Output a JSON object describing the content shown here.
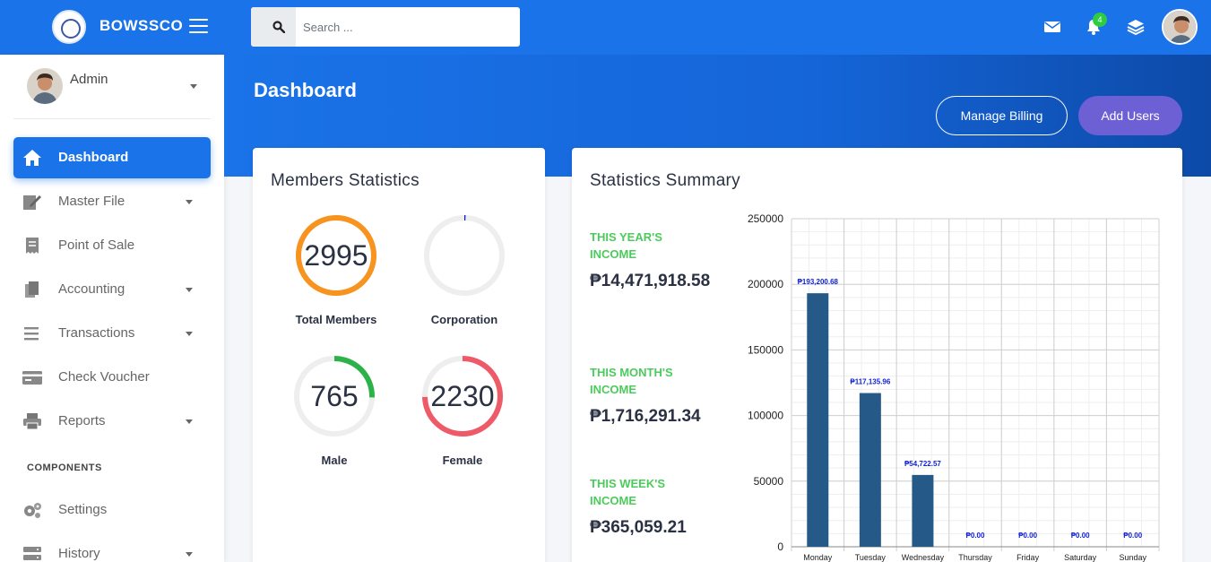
{
  "brand": {
    "name": "BOWSSCO"
  },
  "search": {
    "placeholder": "Search ..."
  },
  "notifications": {
    "count": "4"
  },
  "sidebar": {
    "user": {
      "name": "Admin"
    },
    "items": [
      {
        "label": "Dashboard",
        "icon": "home-icon"
      },
      {
        "label": "Master File",
        "icon": "edit-file-icon"
      },
      {
        "label": "Point of Sale",
        "icon": "receipt-icon"
      },
      {
        "label": "Accounting",
        "icon": "copy-icon"
      },
      {
        "label": "Transactions",
        "icon": "list-icon"
      },
      {
        "label": "Check Voucher",
        "icon": "credit-card-icon"
      },
      {
        "label": "Reports",
        "icon": "printer-icon"
      }
    ],
    "section": "COMPONENTS",
    "components": [
      {
        "label": "Settings",
        "icon": "gears-icon"
      },
      {
        "label": "History",
        "icon": "server-icon"
      }
    ]
  },
  "page": {
    "title": "Dashboard",
    "manage_billing": "Manage Billing",
    "add_users": "Add Users"
  },
  "members": {
    "title": "Members Statistics",
    "total": {
      "value": "2995",
      "label": "Total Members",
      "fraction": 1.0,
      "color": "#f7931e"
    },
    "corporation": {
      "value": "",
      "label": "Corporation",
      "fraction": 0.005,
      "color": "#0022cc"
    },
    "male": {
      "value": "765",
      "label": "Male",
      "fraction": 0.255,
      "color": "#2db24a"
    },
    "female": {
      "value": "2230",
      "label": "Female",
      "fraction": 0.745,
      "color": "#ee5a67"
    }
  },
  "summary": {
    "title": "Statistics Summary",
    "year_label": "THIS YEAR'S INCOME",
    "year_value": "₱14,471,918.58",
    "month_label": "THIS MONTH'S INCOME",
    "month_value": "₱1,716,291.34",
    "week_label": "THIS WEEK'S INCOME",
    "week_value": "₱365,059.21"
  },
  "colors": {
    "primary": "#1a73e8",
    "accent": "#6d5fd4",
    "bar": "#255a88",
    "income_label": "#4ccb5c"
  },
  "chart_data": {
    "type": "bar",
    "categories": [
      "Monday",
      "Tuesday",
      "Wednesday",
      "Thursday",
      "Friday",
      "Saturday",
      "Sunday"
    ],
    "values": [
      193200.68,
      117135.96,
      54722.57,
      0,
      0,
      0,
      0
    ],
    "data_labels": [
      "₱193,200.68",
      "₱117,135.96",
      "₱54,722.57",
      "₱0.00",
      "₱0.00",
      "₱0.00",
      "₱0.00"
    ],
    "y_ticks": [
      "250000",
      "200000",
      "150000",
      "100000",
      "50000",
      "0"
    ],
    "ylim": [
      0,
      250000
    ],
    "grid": true
  }
}
